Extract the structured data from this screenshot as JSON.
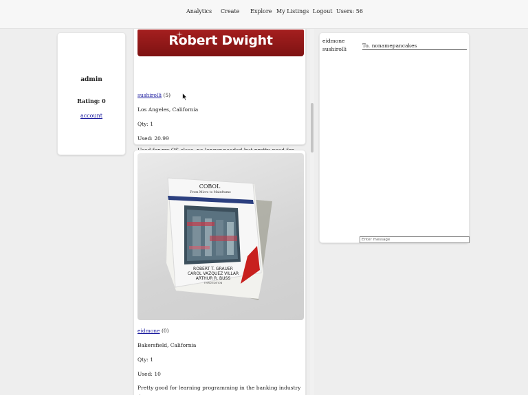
{
  "nav": {
    "analytics": "Analytics",
    "create": "Create",
    "explore": "Explore",
    "my_listings": "My Listings",
    "logout": "Logout",
    "users": "Users: 56"
  },
  "profile": {
    "name": "admin",
    "rating": "Rating: 0",
    "account_link": "account"
  },
  "listings": [
    {
      "banner_text": "Robert Dwight",
      "seller": "sushirolli",
      "seller_rating": "(5)",
      "location": "Los Angeles, California",
      "qty": "Qty: 1",
      "price": "Used: 20.99",
      "description": "Used for my OS class, no longer needed but pretty good for learning about multithreading. Hit me up with any offers"
    },
    {
      "book": {
        "title": "COBOL",
        "subtitle": "From Micro to Mainframe",
        "authors": [
          "ROBERT T. GRAUER",
          "CAROL VAZQUEZ VILLAR",
          "ARTHUR R. BUSS"
        ],
        "edition": "THIRD EDITION"
      },
      "seller": "eidmone",
      "seller_rating": "(0)",
      "location": "Bakersfield, California",
      "qty": "Qty: 1",
      "price": "Used: 10",
      "description": "Pretty good for learning programming in the banking industry :)"
    }
  ],
  "chat": {
    "users": [
      "eidmone",
      "sushirolli"
    ],
    "to": "To. nonamepancakes",
    "message_placeholder": "Enter message"
  },
  "colors": {
    "page_bg": "#eeeeee",
    "card_bg": "#ffffff",
    "link": "#1a1a9e",
    "banner_red": "#a51f1f"
  }
}
